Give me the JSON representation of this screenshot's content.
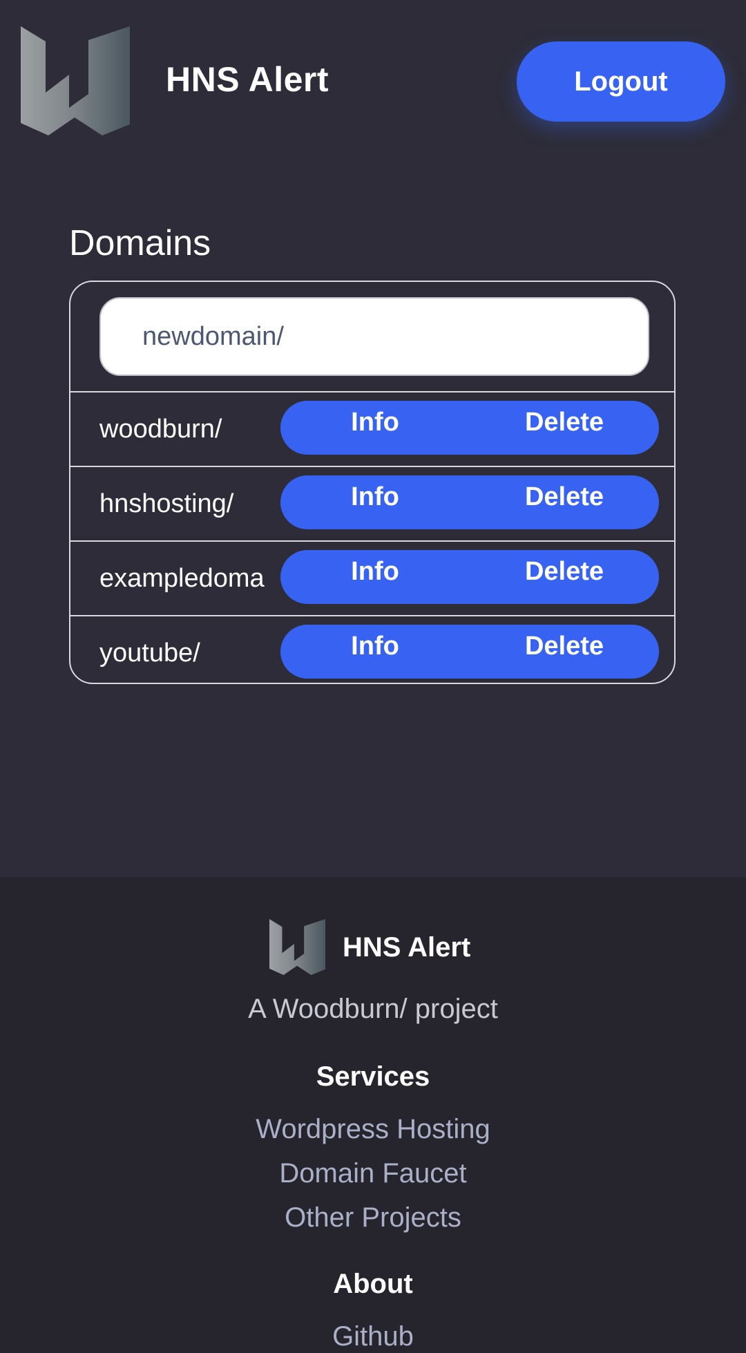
{
  "header": {
    "title": "HNS Alert",
    "logout_label": "Logout"
  },
  "domains": {
    "title": "Domains",
    "new_placeholder": "newdomain/",
    "info_label": "Info",
    "delete_label": "Delete",
    "items": [
      {
        "name": "woodburn/"
      },
      {
        "name": "hnshosting/"
      },
      {
        "name": "exampledoma"
      },
      {
        "name": "youtube/"
      }
    ]
  },
  "footer": {
    "brand": "HNS Alert",
    "tagline": "A Woodburn/ project",
    "services_heading": "Services",
    "services_links": [
      "Wordpress Hosting",
      "Domain Faucet",
      "Other Projects"
    ],
    "about_heading": "About",
    "about_links": [
      "Github"
    ]
  },
  "colors": {
    "accent": "#3863f2",
    "background": "#2d2c38",
    "footer_bg": "#26252e"
  },
  "icons": {
    "logo": "woodburn-w-logo-icon"
  }
}
